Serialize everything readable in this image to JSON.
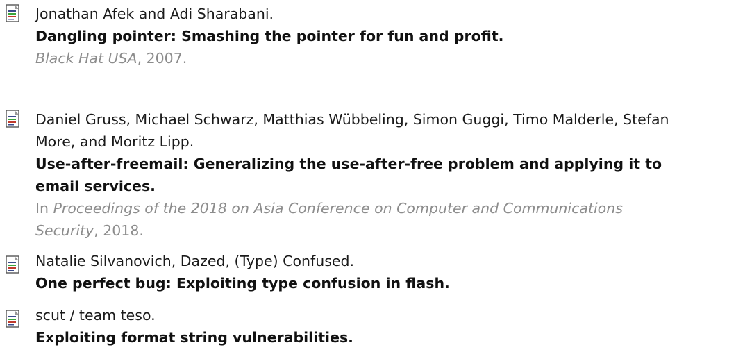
{
  "references": [
    {
      "authors": "Jonathan Afek and Adi Sharabani.",
      "title": "Dangling pointer: Smashing the pointer for fun and profit.",
      "venue_prefix": "",
      "venue_italic": "Black Hat USA",
      "venue_suffix": ", 2007."
    },
    {
      "authors_line1": "Daniel Gruss, Michael Schwarz, Matthias Wübbeling, Simon Guggi, Timo Malderle, Stefan",
      "authors_line2": "More, and Moritz Lipp.",
      "title_line1": "Use-after-freemail: Generalizing the use-after-free problem and applying it to",
      "title_line2": "email services.",
      "venue_prefix": "In ",
      "venue_italic_line1": "Proceedings of the 2018 on Asia Conference on Computer and Communications",
      "venue_italic_line2": "Security",
      "venue_suffix": ", 2018."
    },
    {
      "authors": "Natalie Silvanovich, Dazed, (Type) Confused.",
      "title": "One perfect bug: Exploiting type confusion in flash."
    },
    {
      "authors": "scut / team teso.",
      "title": "Exploiting format string vulnerabilities."
    }
  ],
  "icon": "document-icon",
  "colors": {
    "icon_page": "#ffffff",
    "icon_border": "#555555",
    "icon_fold": "#9a9a9a",
    "icon_lines": "#3a4a8a",
    "icon_green": "#3aa63a",
    "icon_red": "#c0392b",
    "venue_text": "#8c8c8c"
  }
}
